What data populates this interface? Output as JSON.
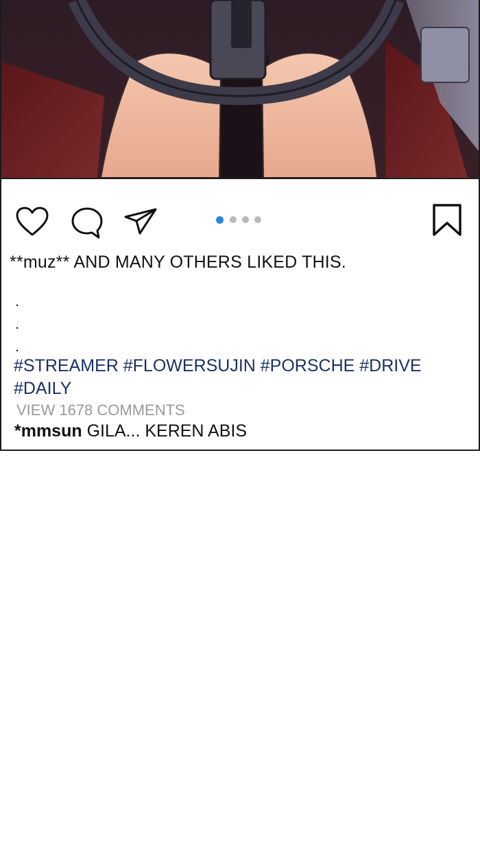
{
  "post": {
    "image_description_icon": "photo-icon",
    "carousel": {
      "count": 4,
      "active_index": 0,
      "active_color": "#2b86e6",
      "inactive_color": "#b9b9b9"
    },
    "icons": {
      "like": "heart-icon",
      "comment": "comment-bubble-icon",
      "share": "paper-plane-icon",
      "save": "bookmark-icon"
    },
    "likes_user": "**muz**",
    "likes_text": " AND MANY OTHERS LIKED THIS.",
    "caption_dots": [
      ".",
      ".",
      "."
    ],
    "hashtags": "#STREAMER #FLOWERSUJIN #PORSCHE #DRIVE #DAILY",
    "view_comments": "VIEW 1678 COMMENTS",
    "comment": {
      "user": "*mmsun",
      "text": " GILA... KEREN ABIS"
    },
    "hashtag_color": "#1c2f66"
  }
}
